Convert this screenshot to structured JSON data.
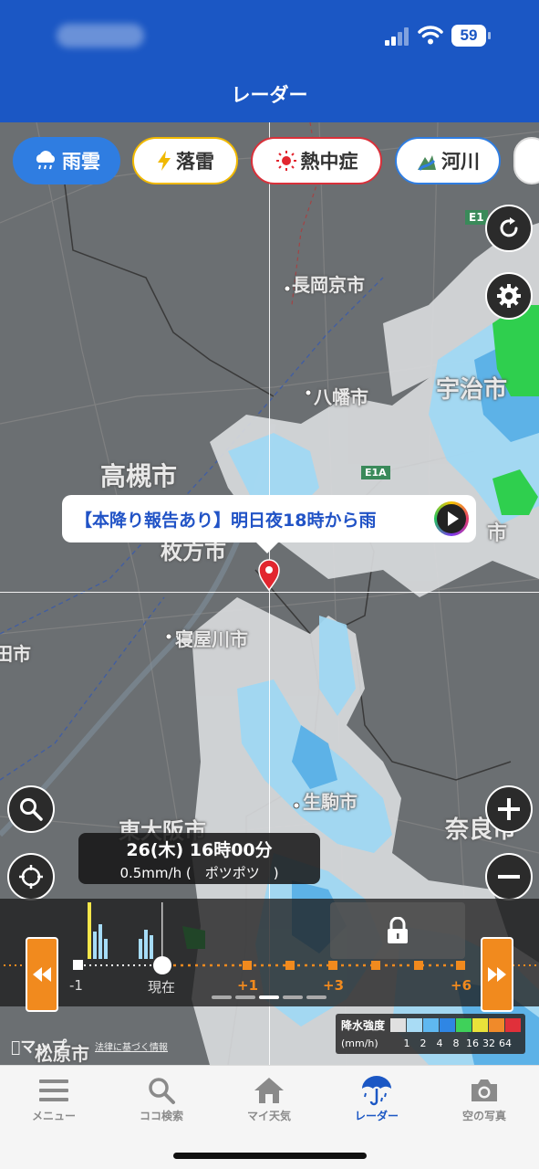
{
  "status_bar": {
    "battery": "59"
  },
  "header": {
    "title": "レーダー"
  },
  "layers": [
    {
      "label": "雨雲",
      "icon": "rain-cloud-icon",
      "active": true
    },
    {
      "label": "落雷",
      "icon": "lightning-icon",
      "active": false
    },
    {
      "label": "熱中症",
      "icon": "sun-icon",
      "active": false
    },
    {
      "label": "河川",
      "icon": "river-icon",
      "active": false
    }
  ],
  "map_labels": {
    "nagaokakyo": "長岡京市",
    "uji": "宇治市",
    "yawata": "八幡市",
    "takatsuki": "高槻市",
    "hirakata": "枚方市",
    "neyagawa": "寝屋川市",
    "ikoma": "生駒市",
    "nara": "奈良市",
    "higashiosaka": "東大阪市",
    "matsubara": "松原市",
    "shi_left": "田市",
    "shi_right": "市",
    "e1": "E1",
    "e1a": "E1A"
  },
  "callout": {
    "text": "【本降り報告あり】明日夜18時から雨"
  },
  "time_display": {
    "datetime": "26(木) 16時00分",
    "intensity": "0.5mm/h (　ポツポツ　)"
  },
  "timeline": {
    "labels": [
      "-1",
      "現在",
      "+1",
      "+3",
      "+6"
    ]
  },
  "legend": {
    "title": "降水強度",
    "unit": "(mm/h)",
    "scale": [
      "1",
      "2",
      "4",
      "8",
      "16",
      "32",
      "64"
    ],
    "colors": [
      "#e0e0e0",
      "#a9dcf5",
      "#5fb8f0",
      "#2f86e4",
      "#3fd15a",
      "#e8e23a",
      "#f08a2a",
      "#e0303a"
    ]
  },
  "attribution": {
    "maps": "マップ",
    "legal": "法律に基づく情報"
  },
  "tabs": [
    {
      "label": "メニュー",
      "icon": "menu-icon"
    },
    {
      "label": "ココ検索",
      "icon": "search-icon"
    },
    {
      "label": "マイ天気",
      "icon": "home-icon"
    },
    {
      "label": "レーダー",
      "icon": "umbrella-icon",
      "active": true
    },
    {
      "label": "空の写真",
      "icon": "camera-icon"
    }
  ]
}
